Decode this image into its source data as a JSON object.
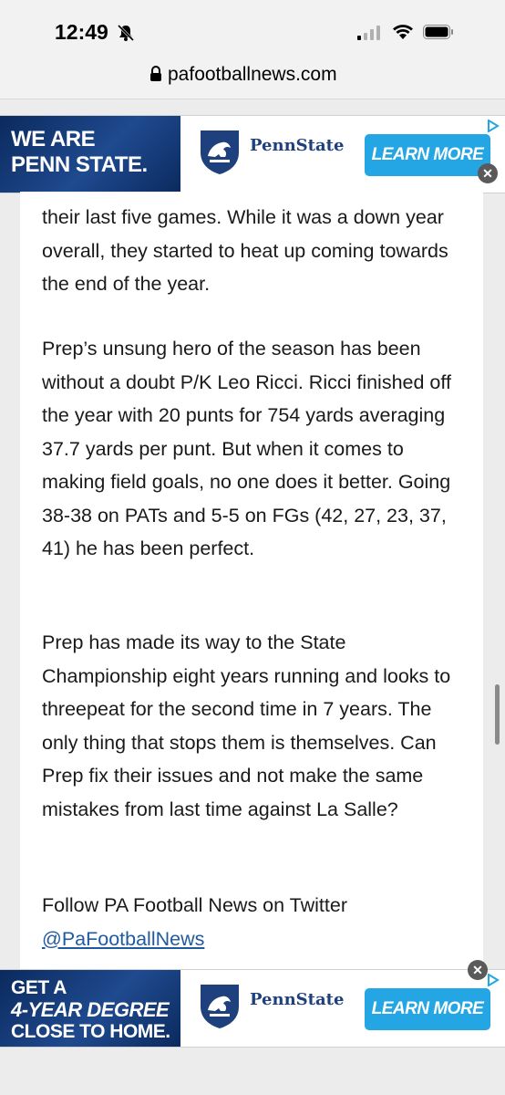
{
  "status_bar": {
    "time": "12:49",
    "icons": [
      "bell-slash-icon",
      "signal-icon",
      "wifi-icon",
      "battery-icon"
    ]
  },
  "browser": {
    "url": "pafootballnews.com"
  },
  "ad_top": {
    "line1": "WE ARE",
    "line2": "PENN STATE.",
    "brand": "PennState",
    "cta": "LEARN MORE"
  },
  "article": {
    "paragraph1": "their last five games. While it was a down year overall, they started to heat up coming towards the end of the year.",
    "paragraph2": "Prep’s unsung hero of the season has been without a doubt P/K Leo Ricci. Ricci finished off the year with 20 punts for 754 yards averaging 37.7 yards per punt. But when it comes to making field goals, no one does it better. Going 38-38 on PATs and 5-5 on FGs (42, 27, 23, 37, 41) he has been perfect.",
    "paragraph3": "Prep has made its way to the State Championship eight years running and looks to threepeat for the second time in 7 years. The only thing that stops them is themselves. Can Prep fix their issues and not make the same mistakes from last time against La Salle?",
    "follow_text": "Follow PA Football News on Twitter",
    "twitter_handle": "@PaFootballNews"
  },
  "ad_bottom": {
    "line1": "GET A",
    "line2": "4-YEAR DEGREE",
    "line3": "CLOSE TO HOME.",
    "brand": "PennState",
    "cta": "LEARN MORE"
  },
  "colors": {
    "brand_navy": "#1e407c",
    "cta_blue": "#23a6e3",
    "link": "#1f5a9e"
  }
}
